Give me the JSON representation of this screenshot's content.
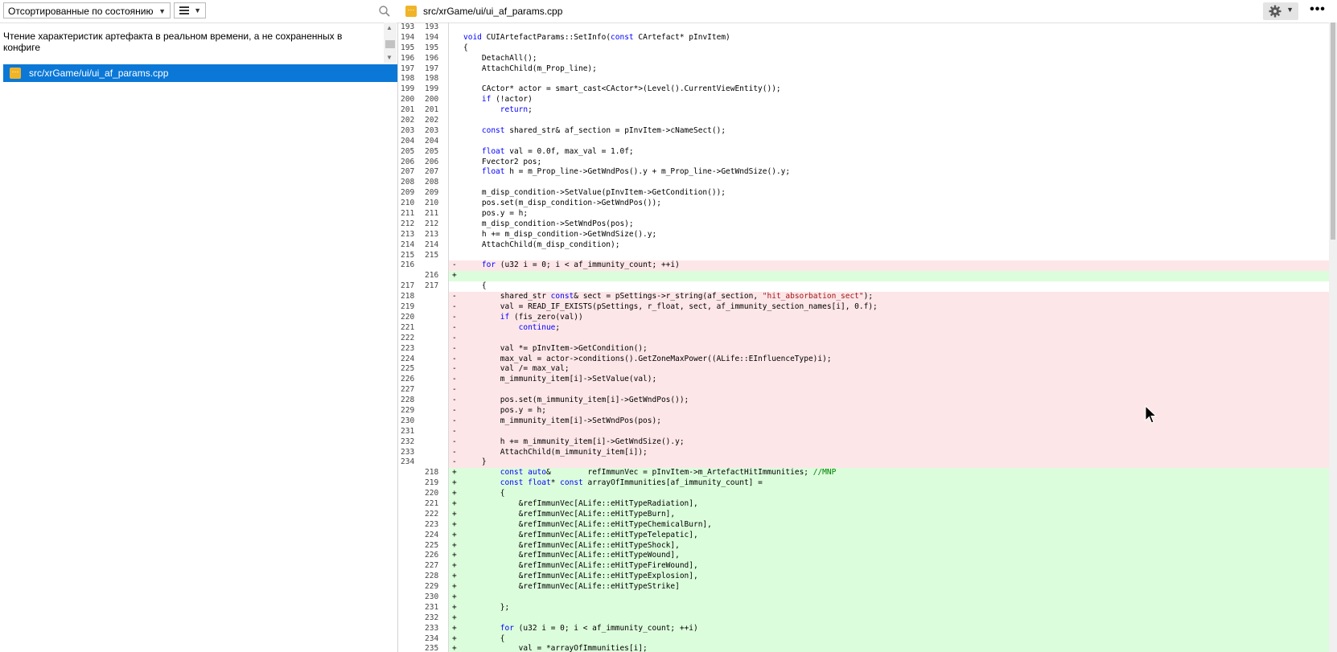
{
  "left_panel": {
    "sort_select": "Отсортированные по состоянию",
    "commit_message": "Чтение характеристик артефакта в реальном времени, а не сохраненных в конфиге",
    "file": "src/xrGame/ui/ui_af_params.cpp"
  },
  "right_panel": {
    "file_path": "src/xrGame/ui/ui_af_params.cpp",
    "more_label": "•••"
  },
  "icons": {
    "search": "search-icon",
    "list_view": "list-view-icon",
    "gear": "gear-icon",
    "file": "cpp-file-icon"
  },
  "colors": {
    "selection": "#0b78d7",
    "deleted_bg": "#fde6e8",
    "added_bg": "#dcfddc",
    "file_icon": "#f0b428"
  },
  "diff_lines": [
    {
      "o": "193",
      "n": "193",
      "m": "",
      "t": ""
    },
    {
      "o": "194",
      "n": "194",
      "m": "",
      "t": "<span class='kw'>void</span> CUIArtefactParams::SetInfo(<span class='kw'>const</span> CArtefact* pInvItem)"
    },
    {
      "o": "195",
      "n": "195",
      "m": "",
      "t": "{"
    },
    {
      "o": "196",
      "n": "196",
      "m": "",
      "t": "    DetachAll();"
    },
    {
      "o": "197",
      "n": "197",
      "m": "",
      "t": "    AttachChild(m_Prop_line);"
    },
    {
      "o": "198",
      "n": "198",
      "m": "",
      "t": ""
    },
    {
      "o": "199",
      "n": "199",
      "m": "",
      "t": "    CActor* actor = smart_cast&lt;CActor*&gt;(Level().CurrentViewEntity());"
    },
    {
      "o": "200",
      "n": "200",
      "m": "",
      "t": "    <span class='kw'>if</span> (!actor)"
    },
    {
      "o": "201",
      "n": "201",
      "m": "",
      "t": "        <span class='kw'>return</span>;"
    },
    {
      "o": "202",
      "n": "202",
      "m": "",
      "t": ""
    },
    {
      "o": "203",
      "n": "203",
      "m": "",
      "t": "    <span class='kw'>const</span> shared_str&amp; af_section = pInvItem-&gt;cNameSect();"
    },
    {
      "o": "204",
      "n": "204",
      "m": "",
      "t": ""
    },
    {
      "o": "205",
      "n": "205",
      "m": "",
      "t": "    <span class='kw'>float</span> val = 0.0f, max_val = 1.0f;"
    },
    {
      "o": "206",
      "n": "206",
      "m": "",
      "t": "    Fvector2 pos;"
    },
    {
      "o": "207",
      "n": "207",
      "m": "",
      "t": "    <span class='kw'>float</span> h = m_Prop_line-&gt;GetWndPos().y + m_Prop_line-&gt;GetWndSize().y;"
    },
    {
      "o": "208",
      "n": "208",
      "m": "",
      "t": ""
    },
    {
      "o": "209",
      "n": "209",
      "m": "",
      "t": "    m_disp_condition-&gt;SetValue(pInvItem-&gt;GetCondition());"
    },
    {
      "o": "210",
      "n": "210",
      "m": "",
      "t": "    pos.set(m_disp_condition-&gt;GetWndPos());"
    },
    {
      "o": "211",
      "n": "211",
      "m": "",
      "t": "    pos.y = h;"
    },
    {
      "o": "212",
      "n": "212",
      "m": "",
      "t": "    m_disp_condition-&gt;SetWndPos(pos);"
    },
    {
      "o": "213",
      "n": "213",
      "m": "",
      "t": "    h += m_disp_condition-&gt;GetWndSize().y;"
    },
    {
      "o": "214",
      "n": "214",
      "m": "",
      "t": "    AttachChild(m_disp_condition);"
    },
    {
      "o": "215",
      "n": "215",
      "m": "",
      "t": ""
    },
    {
      "o": "216",
      "n": "",
      "m": "-",
      "t": "    <span class='kw'>for</span> (u32 i = 0; i &lt; af_immunity_count; ++i)"
    },
    {
      "o": "",
      "n": "216",
      "m": "+",
      "t": ""
    },
    {
      "o": "217",
      "n": "217",
      "m": "",
      "t": "    {"
    },
    {
      "o": "218",
      "n": "",
      "m": "-",
      "t": "        shared_str <span class='kw'>const</span>&amp; sect = pSettings-&gt;r_string(af_section, <span class='str'>\"hit_absorbation_sect\"</span>);"
    },
    {
      "o": "219",
      "n": "",
      "m": "-",
      "t": "        val = READ_IF_EXISTS(pSettings, r_float, sect, af_immunity_section_names[i], 0.f);"
    },
    {
      "o": "220",
      "n": "",
      "m": "-",
      "t": "        <span class='kw'>if</span> (fis_zero(val))"
    },
    {
      "o": "221",
      "n": "",
      "m": "-",
      "t": "            <span class='kw'>continue</span>;"
    },
    {
      "o": "222",
      "n": "",
      "m": "-",
      "t": ""
    },
    {
      "o": "223",
      "n": "",
      "m": "-",
      "t": "        val *= pInvItem-&gt;GetCondition();"
    },
    {
      "o": "224",
      "n": "",
      "m": "-",
      "t": "        max_val = actor-&gt;conditions().GetZoneMaxPower((ALife::EInfluenceType)i);"
    },
    {
      "o": "225",
      "n": "",
      "m": "-",
      "t": "        val /= max_val;"
    },
    {
      "o": "226",
      "n": "",
      "m": "-",
      "t": "        m_immunity_item[i]-&gt;SetValue(val);"
    },
    {
      "o": "227",
      "n": "",
      "m": "-",
      "t": ""
    },
    {
      "o": "228",
      "n": "",
      "m": "-",
      "t": "        pos.set(m_immunity_item[i]-&gt;GetWndPos());"
    },
    {
      "o": "229",
      "n": "",
      "m": "-",
      "t": "        pos.y = h;"
    },
    {
      "o": "230",
      "n": "",
      "m": "-",
      "t": "        m_immunity_item[i]-&gt;SetWndPos(pos);"
    },
    {
      "o": "231",
      "n": "",
      "m": "-",
      "t": ""
    },
    {
      "o": "232",
      "n": "",
      "m": "-",
      "t": "        h += m_immunity_item[i]-&gt;GetWndSize().y;"
    },
    {
      "o": "233",
      "n": "",
      "m": "-",
      "t": "        AttachChild(m_immunity_item[i]);"
    },
    {
      "o": "234",
      "n": "",
      "m": "-",
      "t": "    }"
    },
    {
      "o": "",
      "n": "218",
      "m": "+",
      "t": "        <span class='kw'>const</span> <span class='kw'>auto</span>&amp;        refImmunVec = pInvItem-&gt;m_ArtefactHitImmunities; <span class='cm'>//MNP</span>"
    },
    {
      "o": "",
      "n": "219",
      "m": "+",
      "t": "        <span class='kw'>const</span> <span class='kw'>float</span>* <span class='kw'>const</span> arrayOfImmunities[af_immunity_count] ="
    },
    {
      "o": "",
      "n": "220",
      "m": "+",
      "t": "        {"
    },
    {
      "o": "",
      "n": "221",
      "m": "+",
      "t": "            &amp;refImmunVec[ALife::eHitTypeRadiation],"
    },
    {
      "o": "",
      "n": "222",
      "m": "+",
      "t": "            &amp;refImmunVec[ALife::eHitTypeBurn],"
    },
    {
      "o": "",
      "n": "223",
      "m": "+",
      "t": "            &amp;refImmunVec[ALife::eHitTypeChemicalBurn],"
    },
    {
      "o": "",
      "n": "224",
      "m": "+",
      "t": "            &amp;refImmunVec[ALife::eHitTypeTelepatic],"
    },
    {
      "o": "",
      "n": "225",
      "m": "+",
      "t": "            &amp;refImmunVec[ALife::eHitTypeShock],"
    },
    {
      "o": "",
      "n": "226",
      "m": "+",
      "t": "            &amp;refImmunVec[ALife::eHitTypeWound],"
    },
    {
      "o": "",
      "n": "227",
      "m": "+",
      "t": "            &amp;refImmunVec[ALife::eHitTypeFireWound],"
    },
    {
      "o": "",
      "n": "228",
      "m": "+",
      "t": "            &amp;refImmunVec[ALife::eHitTypeExplosion],"
    },
    {
      "o": "",
      "n": "229",
      "m": "+",
      "t": "            &amp;refImmunVec[ALife::eHitTypeStrike]"
    },
    {
      "o": "",
      "n": "230",
      "m": "+",
      "t": ""
    },
    {
      "o": "",
      "n": "231",
      "m": "+",
      "t": "        };"
    },
    {
      "o": "",
      "n": "232",
      "m": "+",
      "t": ""
    },
    {
      "o": "",
      "n": "233",
      "m": "+",
      "t": "        <span class='kw'>for</span> (u32 i = 0; i &lt; af_immunity_count; ++i)"
    },
    {
      "o": "",
      "n": "234",
      "m": "+",
      "t": "        {"
    },
    {
      "o": "",
      "n": "235",
      "m": "+",
      "t": "            val = *arrayOfImmunities[i];"
    }
  ]
}
